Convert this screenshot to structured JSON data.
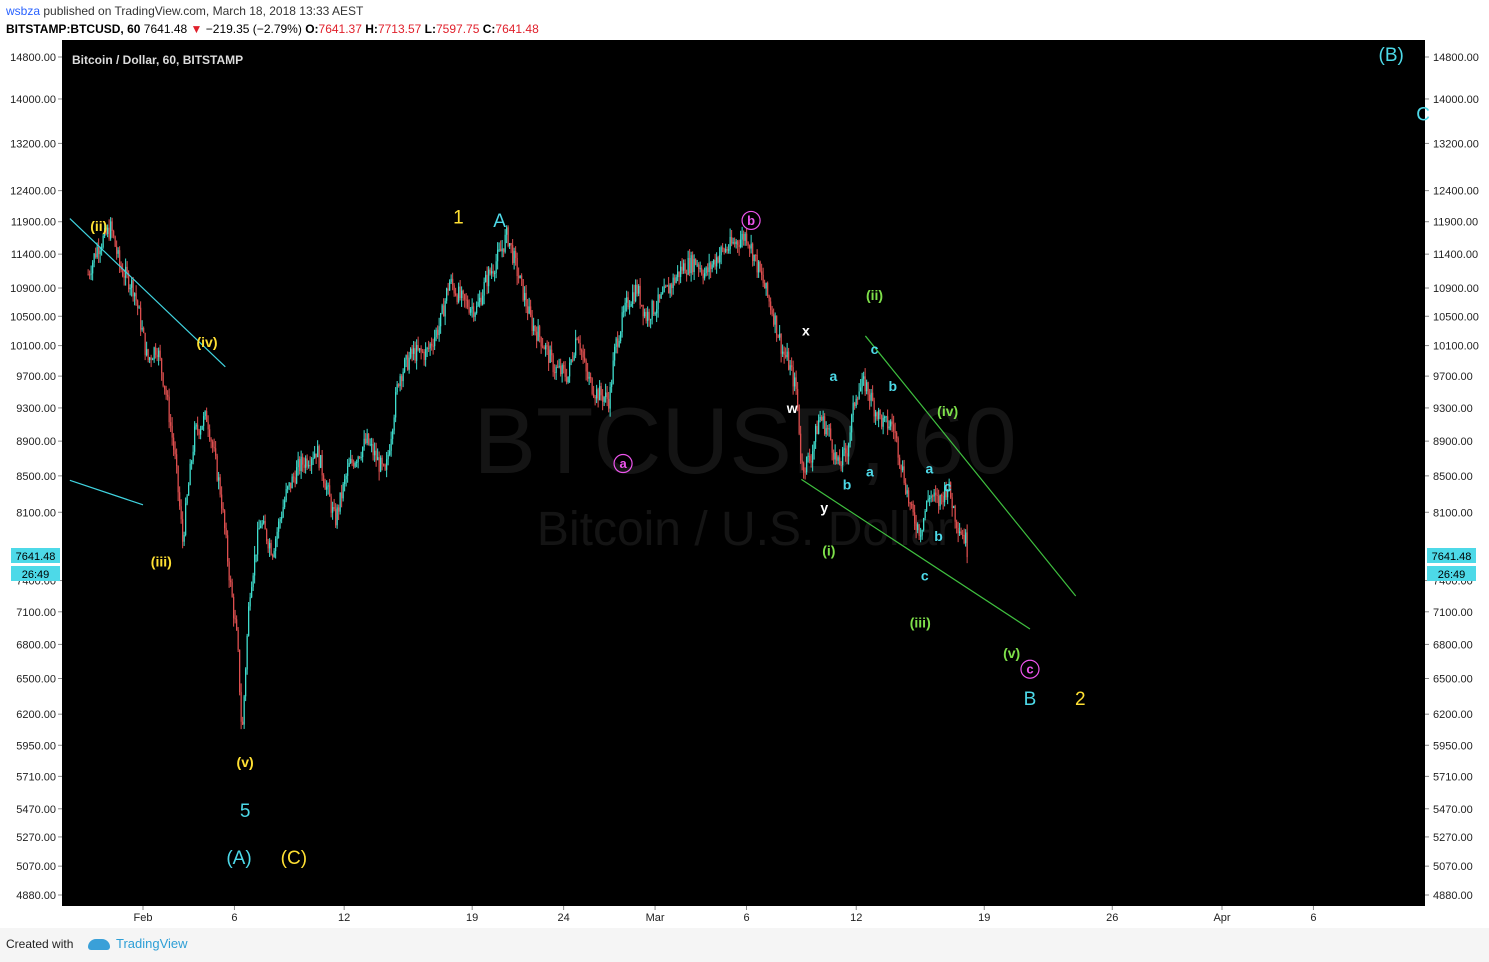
{
  "header": {
    "username": "wsbza",
    "publish_text": " published on TradingView.com, March 18, 2018 13:33 AEST",
    "symbol": "BITSTAMP:BTCUSD, 60",
    "last": "7641.48",
    "change": "−219.35 (−2.79%)",
    "o_label": "O:",
    "o_value": "7641.37",
    "h_label": "H:",
    "h_value": "7713.57",
    "l_label": "L:",
    "l_value": "7597.75",
    "c_label": "C:",
    "c_value": "7641.48"
  },
  "chart_title": "Bitcoin / Dollar, 60, BITSTAMP",
  "watermark": {
    "line1": "BTCUSD, 60",
    "line2": "Bitcoin / U.S. Dollar"
  },
  "price_badge": {
    "price": "7641.48",
    "countdown": "26:49"
  },
  "footer": {
    "created_with": "Created with",
    "brand": "TradingView"
  },
  "colors": {
    "background": "#000000",
    "up": "#40e0d0",
    "down": "#e05050",
    "cyan": "#4dd9e8",
    "yellow": "#ffe033",
    "green": "#7ee04a",
    "magenta": "#ee55ee",
    "white": "#ffffff"
  },
  "chart_data": {
    "type": "candlestick",
    "title": "Bitcoin / Dollar, 60, BITSTAMP",
    "y_ticks": [
      "14800.00",
      "14000.00",
      "13200.00",
      "12400.00",
      "11900.00",
      "11400.00",
      "10900.00",
      "10500.00",
      "10100.00",
      "9700.00",
      "9300.00",
      "8900.00",
      "8500.00",
      "8100.00",
      "7400.00",
      "7100.00",
      "6800.00",
      "6500.00",
      "6200.00",
      "5950.00",
      "5710.00",
      "5470.00",
      "5270.00",
      "5070.00",
      "4880.00"
    ],
    "x_ticks": [
      "Feb",
      "6",
      "12",
      "19",
      "24",
      "Mar",
      "6",
      "12",
      "19",
      "26",
      "Apr",
      "6"
    ],
    "series_path": [
      [
        "2018-01-29T00:00",
        11100
      ],
      [
        "2018-01-29T12:00",
        11500
      ],
      [
        "2018-01-30T06:00",
        11800
      ],
      [
        "2018-01-30T18:00",
        11200
      ],
      [
        "2018-01-31T12:00",
        10900
      ],
      [
        "2018-02-01T06:00",
        9900
      ],
      [
        "2018-02-01T18:00",
        10100
      ],
      [
        "2018-02-02T06:00",
        9500
      ],
      [
        "2018-02-02T18:00",
        8700
      ],
      [
        "2018-02-03T04:00",
        7800
      ],
      [
        "2018-02-03T20:00",
        9000
      ],
      [
        "2018-02-04T12:00",
        9200
      ],
      [
        "2018-02-05T06:00",
        8300
      ],
      [
        "2018-02-05T18:00",
        7400
      ],
      [
        "2018-02-06T04:00",
        6800
      ],
      [
        "2018-02-06T10:00",
        6000
      ],
      [
        "2018-02-06T20:00",
        7300
      ],
      [
        "2018-02-07T10:00",
        8000
      ],
      [
        "2018-02-08T02:00",
        7700
      ],
      [
        "2018-02-08T20:00",
        8300
      ],
      [
        "2018-02-09T12:00",
        8600
      ],
      [
        "2018-02-10T12:00",
        8800
      ],
      [
        "2018-02-11T12:00",
        8000
      ],
      [
        "2018-02-12T06:00",
        8600
      ],
      [
        "2018-02-13T06:00",
        8900
      ],
      [
        "2018-02-14T06:00",
        8500
      ],
      [
        "2018-02-15T00:00",
        9700
      ],
      [
        "2018-02-15T18:00",
        10000
      ],
      [
        "2018-02-16T12:00",
        10000
      ],
      [
        "2018-02-17T06:00",
        10400
      ],
      [
        "2018-02-17T18:00",
        11000
      ],
      [
        "2018-02-18T12:00",
        10700
      ],
      [
        "2018-02-19T06:00",
        10600
      ],
      [
        "2018-02-19T18:00",
        11000
      ],
      [
        "2018-02-20T12:00",
        11400
      ],
      [
        "2018-02-20T22:00",
        11700
      ],
      [
        "2018-02-21T12:00",
        11100
      ],
      [
        "2018-02-22T06:00",
        10400
      ],
      [
        "2018-02-22T18:00",
        10200
      ],
      [
        "2018-02-23T12:00",
        9800
      ],
      [
        "2018-02-24T06:00",
        9700
      ],
      [
        "2018-02-24T18:00",
        10300
      ],
      [
        "2018-02-25T06:00",
        9700
      ],
      [
        "2018-02-25T18:00",
        9500
      ],
      [
        "2018-02-26T12:00",
        9400
      ],
      [
        "2018-02-26T20:00",
        10100
      ],
      [
        "2018-02-27T12:00",
        10700
      ],
      [
        "2018-02-28T00:00",
        10900
      ],
      [
        "2018-02-28T12:00",
        10500
      ],
      [
        "2018-03-01T06:00",
        10700
      ],
      [
        "2018-03-02T00:00",
        11000
      ],
      [
        "2018-03-02T12:00",
        11200
      ],
      [
        "2018-03-03T06:00",
        11300
      ],
      [
        "2018-03-03T18:00",
        11100
      ],
      [
        "2018-03-04T12:00",
        11400
      ],
      [
        "2018-03-05T12:00",
        11600
      ],
      [
        "2018-03-06T00:00",
        11700
      ],
      [
        "2018-03-06T12:00",
        11300
      ],
      [
        "2018-03-07T00:00",
        10900
      ],
      [
        "2018-03-07T12:00",
        10500
      ],
      [
        "2018-03-08T00:00",
        10000
      ],
      [
        "2018-03-08T06:00",
        9900
      ],
      [
        "2018-03-08T18:00",
        9500
      ],
      [
        "2018-03-09T00:00",
        8600
      ],
      [
        "2018-03-09T12:00",
        8700
      ],
      [
        "2018-03-10T00:00",
        9200
      ],
      [
        "2018-03-10T12:00",
        9000
      ],
      [
        "2018-03-11T00:00",
        8600
      ],
      [
        "2018-03-11T12:00",
        8800
      ],
      [
        "2018-03-12T00:00",
        9500
      ],
      [
        "2018-03-12T12:00",
        9600
      ],
      [
        "2018-03-13T00:00",
        9300
      ],
      [
        "2018-03-13T12:00",
        9100
      ],
      [
        "2018-03-14T00:00",
        9100
      ],
      [
        "2018-03-14T12:00",
        8600
      ],
      [
        "2018-03-15T00:00",
        8100
      ],
      [
        "2018-03-15T12:00",
        7900
      ],
      [
        "2018-03-16T00:00",
        8300
      ],
      [
        "2018-03-16T12:00",
        8200
      ],
      [
        "2018-03-17T00:00",
        8400
      ],
      [
        "2018-03-17T12:00",
        8000
      ],
      [
        "2018-03-18T00:00",
        7800
      ],
      [
        "2018-03-18T03:00",
        7641.48
      ]
    ],
    "trendlines": [
      {
        "color": "#40d4e0",
        "points": [
          [
            "2018-01-28T00:00",
            11950
          ],
          [
            "2018-02-05T12:00",
            9820
          ]
        ]
      },
      {
        "color": "#40d4e0",
        "points": [
          [
            "2018-01-28T00:00",
            8450
          ],
          [
            "2018-02-01T00:00",
            8180
          ]
        ]
      },
      {
        "color": "#3fbf3f",
        "points": [
          [
            "2018-03-12T12:00",
            10230
          ],
          [
            "2018-03-24T00:00",
            7250
          ]
        ]
      },
      {
        "color": "#3fbf3f",
        "points": [
          [
            "2018-03-09T00:00",
            8460
          ],
          [
            "2018-03-21T12:00",
            6940
          ]
        ]
      }
    ],
    "annotations": [
      {
        "text": "(ii)",
        "color": "yellow",
        "t": "2018-01-29T14:00",
        "p": 11830
      },
      {
        "text": "(iv)",
        "color": "yellow",
        "t": "2018-02-04T12:00",
        "p": 10150
      },
      {
        "text": "(iii)",
        "color": "yellow",
        "t": "2018-02-02T00:00",
        "p": 7590
      },
      {
        "text": "(v)",
        "color": "yellow",
        "t": "2018-02-06T14:00",
        "p": 5820
      },
      {
        "text": "5",
        "color": "cyan",
        "t": "2018-02-06T14:00",
        "p": 5460
      },
      {
        "text": "(A)",
        "color": "cyan",
        "t": "2018-02-06T06:00",
        "p": 5130
      },
      {
        "text": "(C)",
        "color": "yellow",
        "t": "2018-02-09T06:00",
        "p": 5130
      },
      {
        "text": "1",
        "color": "yellow",
        "t": "2018-02-18T06:00",
        "p": 11980
      },
      {
        "text": "A",
        "color": "cyan",
        "t": "2018-02-20T12:00",
        "p": 11920
      },
      {
        "text": "a",
        "color": "magenta",
        "circle": true,
        "t": "2018-02-27T06:00",
        "p": 8640
      },
      {
        "text": "b",
        "color": "magenta",
        "circle": true,
        "t": "2018-03-06T06:00",
        "p": 11920
      },
      {
        "text": "x",
        "color": "white",
        "t": "2018-03-09T06:00",
        "p": 10300
      },
      {
        "text": "w",
        "color": "white",
        "t": "2018-03-08T12:00",
        "p": 9300
      },
      {
        "text": "y",
        "color": "white",
        "t": "2018-03-10T06:00",
        "p": 8150
      },
      {
        "text": "a",
        "color": "cyan",
        "t": "2018-03-10T18:00",
        "p": 9700
      },
      {
        "text": "b",
        "color": "cyan",
        "t": "2018-03-11T12:00",
        "p": 8400
      },
      {
        "text": "a",
        "color": "cyan",
        "t": "2018-03-12T18:00",
        "p": 8550
      },
      {
        "text": "(ii)",
        "color": "green",
        "t": "2018-03-13T00:00",
        "p": 10800
      },
      {
        "text": "c",
        "color": "cyan",
        "t": "2018-03-13T00:00",
        "p": 10050
      },
      {
        "text": "b",
        "color": "cyan",
        "t": "2018-03-14T00:00",
        "p": 9570
      },
      {
        "text": "(iv)",
        "color": "green",
        "t": "2018-03-17T00:00",
        "p": 9260
      },
      {
        "text": "a",
        "color": "cyan",
        "t": "2018-03-16T00:00",
        "p": 8580
      },
      {
        "text": "c",
        "color": "cyan",
        "t": "2018-03-17T00:00",
        "p": 8380
      },
      {
        "text": "b",
        "color": "cyan",
        "t": "2018-03-16T12:00",
        "p": 7850
      },
      {
        "text": "(i)",
        "color": "green",
        "t": "2018-03-10T12:00",
        "p": 7700
      },
      {
        "text": "c",
        "color": "cyan",
        "t": "2018-03-15T18:00",
        "p": 7450
      },
      {
        "text": "(iii)",
        "color": "green",
        "t": "2018-03-15T12:00",
        "p": 7000
      },
      {
        "text": "(v)",
        "color": "green",
        "t": "2018-03-20T12:00",
        "p": 6720
      },
      {
        "text": "c",
        "color": "magenta",
        "circle": true,
        "t": "2018-03-21T12:00",
        "p": 6580
      },
      {
        "text": "B",
        "color": "cyan",
        "t": "2018-03-21T12:00",
        "p": 6330
      },
      {
        "text": "2",
        "color": "yellow",
        "t": "2018-03-24T06:00",
        "p": 6330
      },
      {
        "text": "(B)",
        "color": "cyan",
        "t": "2018-04-10T06:00",
        "p": 14850
      },
      {
        "text": "C",
        "color": "cyan",
        "t": "2018-04-12T00:00",
        "p": 13730
      }
    ]
  }
}
